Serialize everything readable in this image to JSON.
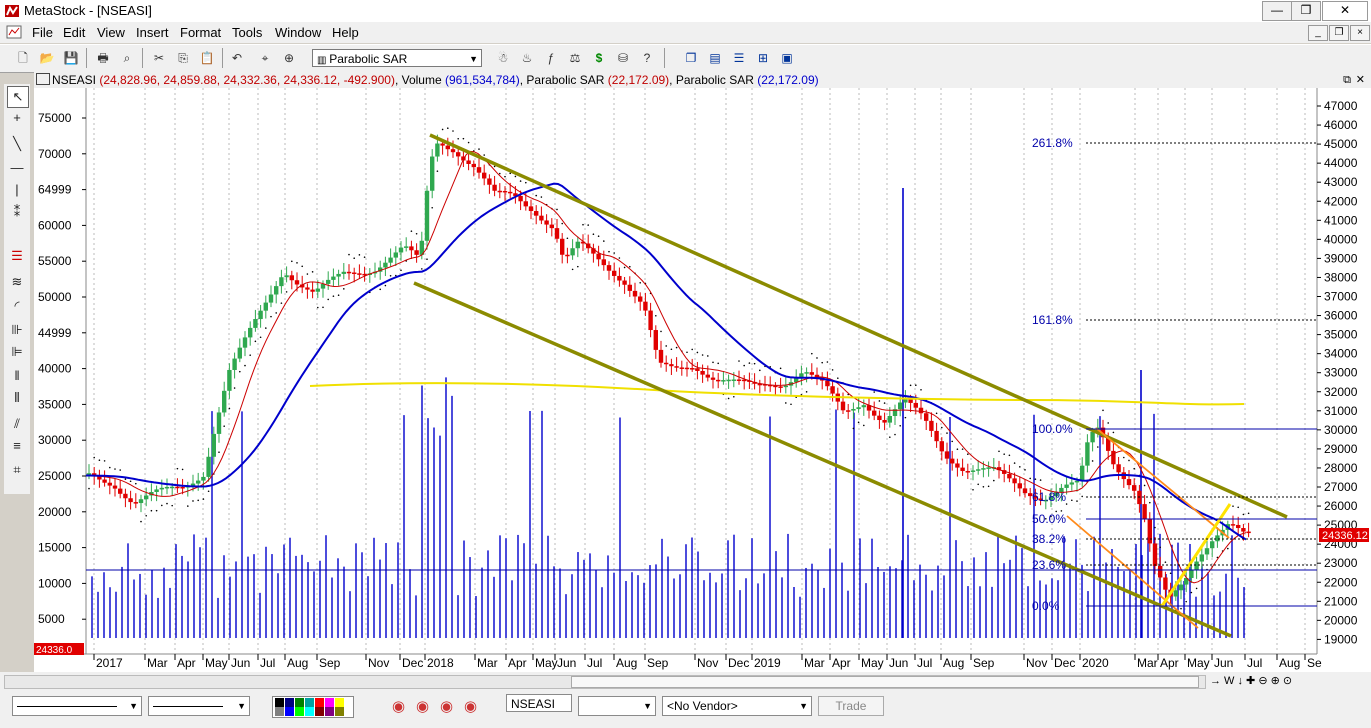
{
  "window": {
    "title": "MetaStock - [NSEASI]",
    "min": "—",
    "max": "❒",
    "close": "✕"
  },
  "menu": [
    "File",
    "Edit",
    "View",
    "Insert",
    "Format",
    "Tools",
    "Window",
    "Help"
  ],
  "mdi": {
    "min": "_",
    "restore": "❐",
    "close": "×"
  },
  "toolbar": {
    "indicator": "Parabolic SAR"
  },
  "chart": {
    "header_symbol": "NSEASI",
    "header_ohlc": "(24,828.96, 24,859.88, 24,332.36, 24,336.12, -492.900)",
    "header_volume_label": "Volume",
    "header_volume": "(961,534,784)",
    "header_sar1_label": "Parabolic SAR",
    "header_sar1": "(22,172.09)",
    "header_sar2_label": "Parabolic SAR",
    "header_sar2": "(22,172.09)",
    "left_axis": [
      "75000",
      "70000",
      "64999",
      "60000",
      "55000",
      "50000",
      "44999",
      "40000",
      "35000",
      "30000",
      "25000",
      "20000",
      "15000",
      "10000",
      "5000"
    ],
    "right_axis": [
      "47000",
      "46000",
      "45000",
      "44000",
      "43000",
      "42000",
      "41000",
      "40000",
      "39000",
      "38000",
      "37000",
      "36000",
      "35000",
      "34000",
      "33000",
      "32000",
      "31000",
      "30000",
      "29000",
      "28000",
      "27000",
      "26000",
      "25000",
      "24000",
      "23000",
      "22000",
      "21000",
      "20000",
      "19000"
    ],
    "x_labels": [
      "2017",
      "Mar",
      "Apr",
      "May",
      "Jun",
      "Jul",
      "Aug",
      "Sep",
      "Nov",
      "Dec",
      "2018",
      "Mar",
      "Apr",
      "May",
      "Jun",
      "Jul",
      "Aug",
      "Sep",
      "Nov",
      "Dec",
      "2019",
      "Mar",
      "Apr",
      "May",
      "Jun",
      "Jul",
      "Aug",
      "Sep",
      "Nov",
      "Dec",
      "2020",
      "Mar",
      "Apr",
      "May",
      "Jun",
      "Jul",
      "Aug",
      "Se"
    ],
    "fib_labels": [
      "261.8%",
      "161.8%",
      "100.0%",
      "61.8%",
      "50.0%",
      "38.2%",
      "23.6%",
      "0.0%"
    ],
    "last_price": "24336.12",
    "last_volume": "24336.0",
    "colors": {
      "up": "#2fa84f",
      "down": "#e00000",
      "ma_blue": "#0000cc",
      "ma_red": "#cc0000",
      "ma_yellow": "#f0e000",
      "channel": "#8b8b00",
      "fib": "#0000aa"
    }
  },
  "status": {
    "symbol": "NSEASI",
    "vendor": "<No Vendor>",
    "trade": "Trade",
    "nav": "→ W ↓ ✚ ⊖ ⊕ ⊙"
  }
}
